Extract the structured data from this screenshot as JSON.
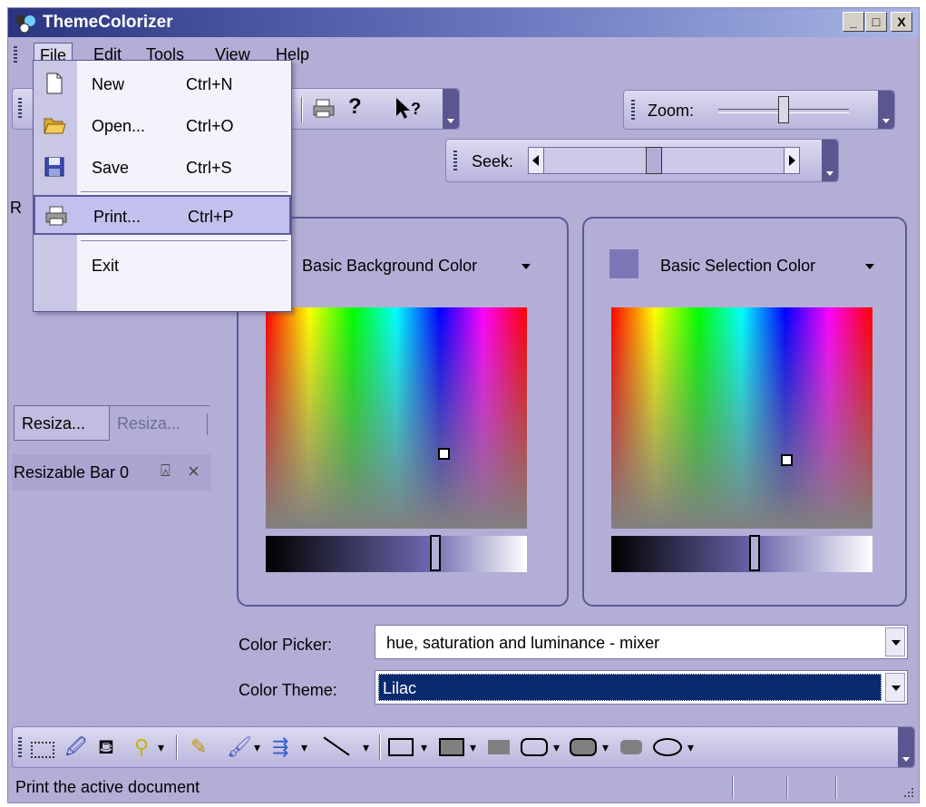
{
  "window": {
    "title": "ThemeColorizer",
    "controls": {
      "minimize": "_",
      "maximize": "□",
      "close": "X"
    }
  },
  "menubar": {
    "items": [
      {
        "label": "File"
      },
      {
        "label": "Edit"
      },
      {
        "label": "Tools"
      },
      {
        "label": "View"
      },
      {
        "label": "Help"
      }
    ]
  },
  "file_menu": {
    "items": [
      {
        "label": "New",
        "shortcut": "Ctrl+N",
        "icon": "new-document-icon"
      },
      {
        "label": "Open...",
        "shortcut": "Ctrl+O",
        "icon": "open-folder-icon"
      },
      {
        "label": "Save",
        "shortcut": "Ctrl+S",
        "icon": "save-disk-icon"
      },
      {
        "label": "Print...",
        "shortcut": "Ctrl+P",
        "icon": "printer-icon",
        "highlighted": true
      },
      {
        "label": "Exit",
        "shortcut": ""
      }
    ]
  },
  "toolbars": {
    "zoom_label": "Zoom:",
    "seek_label": "Seek:",
    "zoom_level": 0.5,
    "seek_level": 0.45
  },
  "left_dock": {
    "partial_label": "R",
    "tabs": [
      {
        "label": "Resiza..."
      },
      {
        "label": "Resiza..."
      }
    ],
    "bar_title": "Resizable Bar 0",
    "pin_glyph": "⍓",
    "close_glyph": "×"
  },
  "panels": {
    "background": {
      "title": "Basic Background Color",
      "marker": [
        0.68,
        0.66
      ],
      "luminance": 0.65
    },
    "selection": {
      "title": "Basic Selection Color",
      "swatch": "#7c78b8",
      "marker": [
        0.67,
        0.69
      ],
      "luminance": 0.55
    }
  },
  "form": {
    "picker_label": "Color Picker:",
    "picker_value": "hue, saturation and luminance - mixer",
    "theme_label": "Color Theme:",
    "theme_value": "Lilac"
  },
  "statusbar": {
    "text": "Print the active document"
  },
  "colors": {
    "window_bg": "#b3aed6",
    "accent": "#5b5a9a",
    "selected_combo": "#0a2a6e"
  }
}
